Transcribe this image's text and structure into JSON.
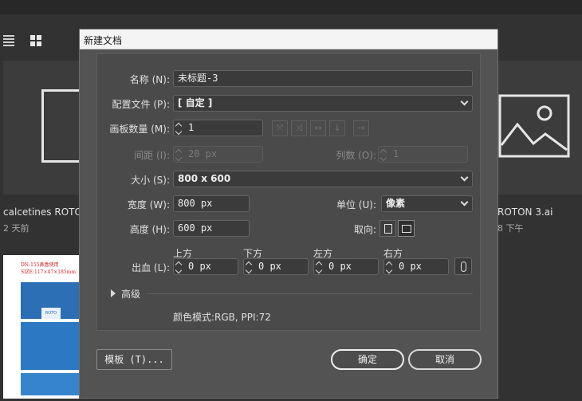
{
  "background": {
    "tile1_title": "calcetines ROTO",
    "tile1_sub": "2 天前",
    "tile2_title": "ROTON 3.ai",
    "tile2_sub": "8 下午",
    "thumb_text": "DN-155鼻盒使用\nSIZE:117×47×185mm",
    "thumb_tag": "ROTO"
  },
  "dialog": {
    "title": "新建文档",
    "name_label": "名称 (N):",
    "name_value": "未标题-3",
    "profile_label": "配置文件 (P):",
    "profile_value": "[ 自定 ]",
    "artboards_label": "画板数量 (M):",
    "artboards_value": "1",
    "spacing_label": "间距 (I):",
    "spacing_value": "20 px",
    "columns_label": "列数 (O):",
    "columns_value": "1",
    "size_label": "大小 (S):",
    "size_value": "800 x 600",
    "width_label": "宽度 (W):",
    "width_value": "800 px",
    "units_label": "单位 (U):",
    "units_value": "像素",
    "height_label": "高度 (H):",
    "height_value": "600 px",
    "orientation_label": "取向:",
    "bleed_label": "出血 (L):",
    "bleed_top_label": "上方",
    "bleed_bottom_label": "下方",
    "bleed_left_label": "左方",
    "bleed_right_label": "右方",
    "bleed_top": "0 px",
    "bleed_bottom": "0 px",
    "bleed_left": "0 px",
    "bleed_right": "0 px",
    "advanced_label": "高级",
    "color_mode": "颜色模式:RGB, PPI:72",
    "templates_button": "模板 (T)...",
    "ok_button": "确定",
    "cancel_button": "取消"
  },
  "colors": {
    "app_bg": "#323232",
    "dialog_bg": "#535353",
    "field_bg": "#3b3b3b",
    "titlebar_bg": "#f4f4f4",
    "thumb_blue": "#2c6fb4"
  }
}
